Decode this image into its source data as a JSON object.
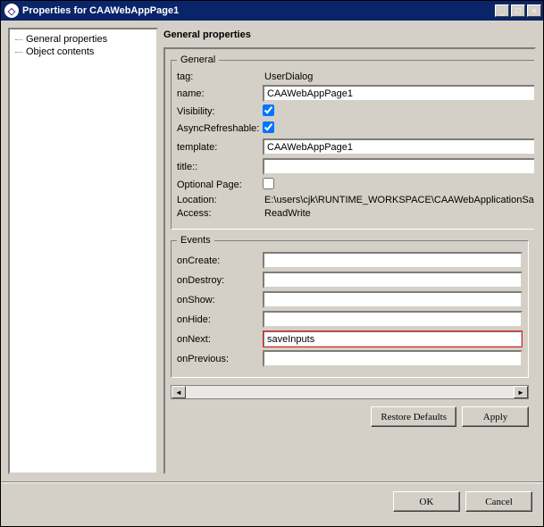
{
  "window": {
    "title": "Properties for CAAWebAppPage1",
    "btn_min": "_",
    "btn_max": "□",
    "btn_close": "×"
  },
  "sidebar": {
    "items": [
      {
        "label": "General properties"
      },
      {
        "label": "Object contents"
      }
    ]
  },
  "main": {
    "title": "General properties"
  },
  "general": {
    "legend": "General",
    "tag_label": "tag:",
    "tag_value": "UserDialog",
    "name_label": "name:",
    "name_value": "CAAWebAppPage1",
    "visibility_label": "Visibility:",
    "visibility_checked": true,
    "async_label": "AsyncRefreshable:",
    "async_checked": true,
    "template_label": "template:",
    "template_value": "CAAWebAppPage1",
    "title_label": "title::",
    "title_value": "",
    "optional_label": "Optional Page:",
    "optional_checked": false,
    "location_label": "Location:",
    "location_value": "E:\\users\\cjk\\RUNTIME_WORKSPACE\\CAAWebApplicationSam",
    "access_label": "Access:",
    "access_value": "ReadWrite"
  },
  "events": {
    "legend": "Events",
    "onCreate_label": "onCreate:",
    "onCreate_value": "",
    "onDestroy_label": "onDestroy:",
    "onDestroy_value": "",
    "onShow_label": "onShow:",
    "onShow_value": "",
    "onHide_label": "onHide:",
    "onHide_value": "",
    "onNext_label": "onNext:",
    "onNext_value": "saveInputs",
    "onPrevious_label": "onPrevious:",
    "onPrevious_value": ""
  },
  "buttons": {
    "restore": "Restore Defaults",
    "apply": "Apply",
    "ok": "OK",
    "cancel": "Cancel"
  }
}
